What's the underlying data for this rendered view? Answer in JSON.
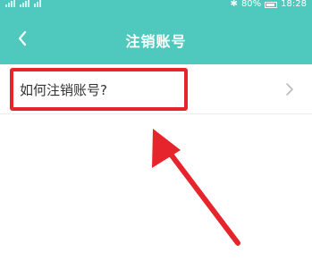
{
  "status_bar": {
    "battery": "80%",
    "time": "18:28"
  },
  "header": {
    "title": "注销账号",
    "back_icon": "chevron-left-icon"
  },
  "menu": {
    "items": [
      {
        "label": "如何注销账号?",
        "icon": "chevron-right-icon"
      }
    ]
  },
  "annotation": {
    "color": "#e5252b"
  },
  "colors": {
    "header_bg": "#4fc9bd",
    "text": "#333333",
    "chevron": "#bbbbbb"
  }
}
